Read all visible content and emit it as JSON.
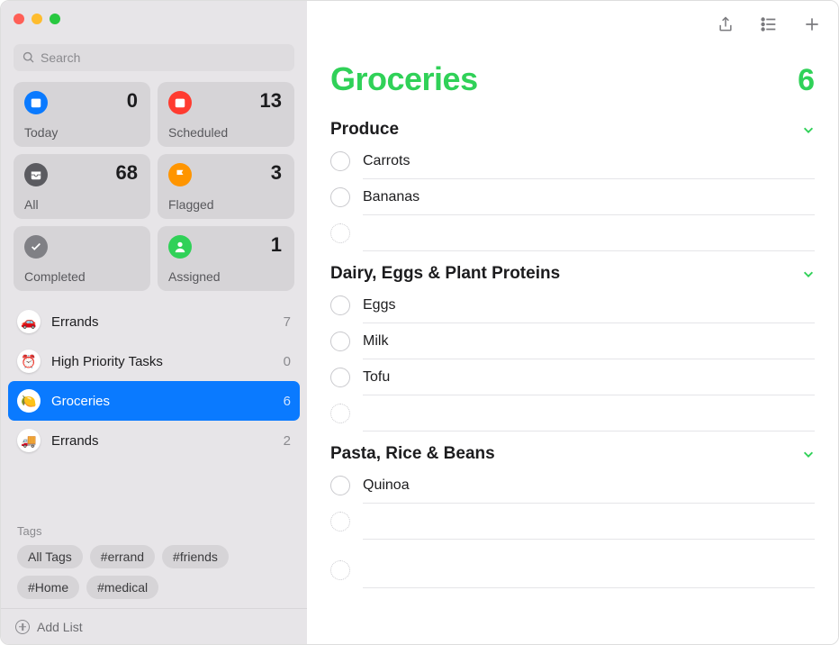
{
  "search": {
    "placeholder": "Search"
  },
  "smart": {
    "today": {
      "label": "Today",
      "count": "0"
    },
    "scheduled": {
      "label": "Scheduled",
      "count": "13"
    },
    "all": {
      "label": "All",
      "count": "68"
    },
    "flagged": {
      "label": "Flagged",
      "count": "3"
    },
    "completed": {
      "label": "Completed",
      "count": ""
    },
    "assigned": {
      "label": "Assigned",
      "count": "1"
    }
  },
  "lists": [
    {
      "name": "Errands",
      "count": "7",
      "emoji": "🚗",
      "selected": false
    },
    {
      "name": "High Priority Tasks",
      "count": "0",
      "emoji": "⏰",
      "selected": false
    },
    {
      "name": "Groceries",
      "count": "6",
      "emoji": "🍋",
      "selected": true
    },
    {
      "name": "Errands",
      "count": "2",
      "emoji": "🚚",
      "selected": false
    }
  ],
  "tags": {
    "title": "Tags",
    "items": [
      "All Tags",
      "#errand",
      "#friends",
      "#Home",
      "#medical"
    ]
  },
  "addList": {
    "label": "Add List"
  },
  "mainList": {
    "title": "Groceries",
    "total": "6",
    "sections": [
      {
        "title": "Produce",
        "items": [
          "Carrots",
          "Bananas"
        ]
      },
      {
        "title": "Dairy, Eggs & Plant Proteins",
        "items": [
          "Eggs",
          "Milk",
          "Tofu"
        ]
      },
      {
        "title": "Pasta, Rice & Beans",
        "items": [
          "Quinoa"
        ]
      }
    ]
  }
}
